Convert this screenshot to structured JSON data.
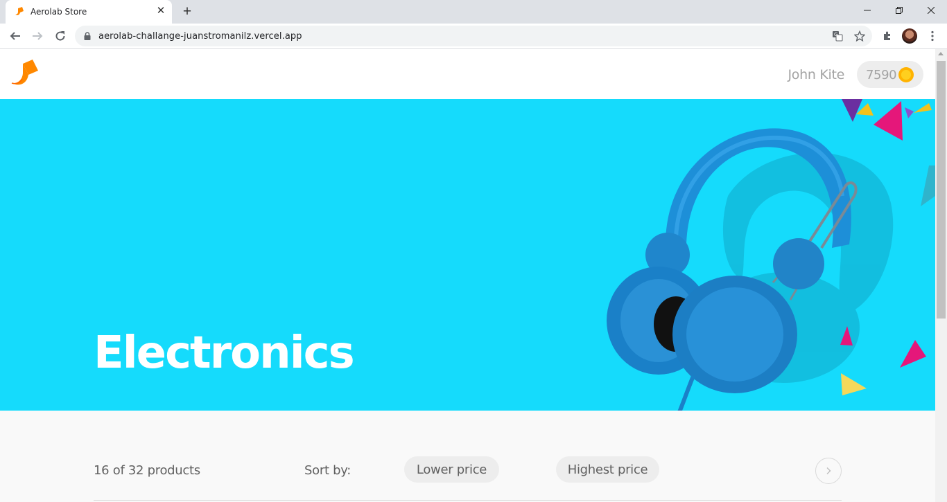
{
  "browser": {
    "tab_title": "Aerolab Store",
    "url": "aerolab-challange-juanstromanilz.vercel.app"
  },
  "header": {
    "user_name": "John Kite",
    "points": "7590"
  },
  "hero": {
    "title": "Electronics"
  },
  "filters": {
    "count_text": "16 of 32 products",
    "sort_label": "Sort by:",
    "options": [
      "Lower price",
      "Highest price"
    ]
  },
  "colors": {
    "hero_bg": "#15dbfc",
    "brand_orange": "#ff8800",
    "pill_bg": "#ededed",
    "text_muted": "#a3a3a3"
  },
  "icons": [
    "aerolab-logo-icon",
    "close-icon",
    "plus-icon",
    "back-icon",
    "forward-icon",
    "reload-icon",
    "lock-icon",
    "translate-icon",
    "star-icon",
    "extensions-icon",
    "menu-icon",
    "coin-icon",
    "chevron-right-icon"
  ]
}
